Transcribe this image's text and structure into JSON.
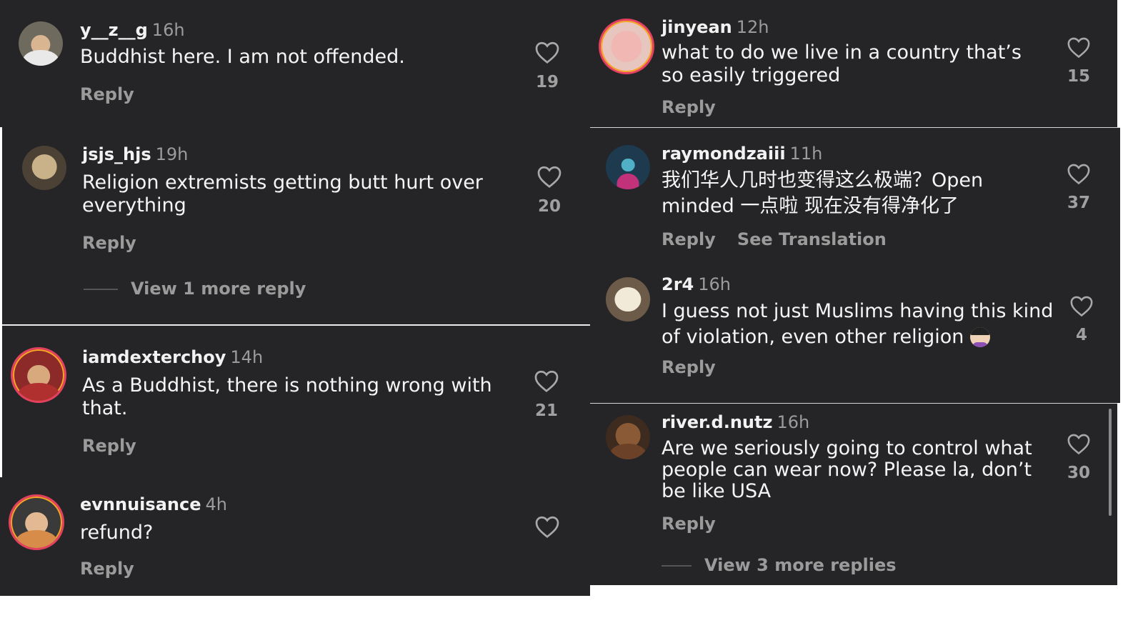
{
  "left_column": {
    "comments": [
      {
        "username": "y__z__g",
        "time": "16h",
        "text": "Buddhist here. I am not offended.",
        "reply": "Reply",
        "likes": "19"
      },
      {
        "username": "jsjs_hjs",
        "time": "19h",
        "text": "Religion extremists getting butt hurt over everything",
        "reply": "Reply",
        "likes": "20",
        "view_more": "View 1 more reply"
      },
      {
        "username": "iamdexterchoy",
        "time": "14h",
        "text": "As a Buddhist, there is nothing wrong with that.",
        "reply": "Reply",
        "likes": "21"
      },
      {
        "username": "evnnuisance",
        "time": "4h",
        "text": "refund?",
        "reply": "Reply",
        "likes": ""
      }
    ]
  },
  "right_column": {
    "comments": [
      {
        "username": "jinyean",
        "time": "12h",
        "text": "what to do we live in a country that’s so easily triggered",
        "reply": "Reply",
        "likes": "15"
      },
      {
        "username": "raymondzaiii",
        "time": "11h",
        "text": "我们华人几时也变得这么极端？Open minded 一点啦 现在没有得净化了",
        "reply": "Reply",
        "see_translation": "See Translation",
        "likes": "37"
      },
      {
        "username": "2r4",
        "time": "16h",
        "text": "I guess not just Muslims having this kind of violation, even other religion",
        "reply": "Reply",
        "likes": "4"
      },
      {
        "username": "river.d.nutz",
        "time": "16h",
        "text": "Are we seriously going to control what people can wear now? Please la, don’t be like USA",
        "reply": "Reply",
        "likes": "30",
        "view_more": "View 3 more replies"
      }
    ]
  },
  "icons": {
    "like": "heart-outline-icon",
    "emoji": "woman-facepalming-emoji"
  },
  "colors": {
    "background": "#252527",
    "text": "#f5f5f5",
    "muted": "#9b9b9b",
    "story_ring": "#e4405f"
  }
}
